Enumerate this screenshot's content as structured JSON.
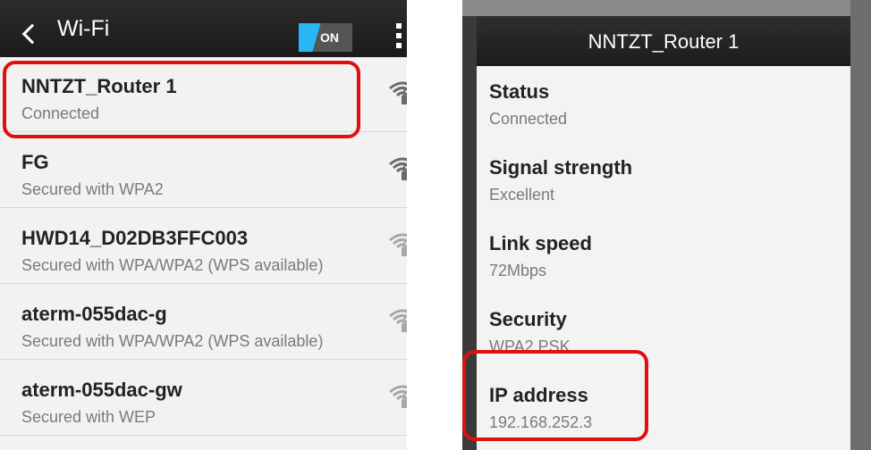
{
  "left": {
    "title": "Wi-Fi",
    "toggle_label": "ON",
    "networks": [
      {
        "name": "NNTZT_Router 1",
        "status": "Connected",
        "signal_icon": "wifi-locked-strong-icon"
      },
      {
        "name": "FG",
        "status": "Secured with WPA2",
        "signal_icon": "wifi-locked-strong-icon"
      },
      {
        "name": "HWD14_D02DB3FFC003",
        "status": "Secured with WPA/WPA2 (WPS available)",
        "signal_icon": "wifi-locked-weak-icon"
      },
      {
        "name": "aterm-055dac-g",
        "status": "Secured with WPA/WPA2 (WPS available)",
        "signal_icon": "wifi-locked-weak-icon"
      },
      {
        "name": "aterm-055dac-gw",
        "status": "Secured with WEP",
        "signal_icon": "wifi-locked-weak-icon"
      }
    ]
  },
  "right": {
    "dialog_title": "NNTZT_Router 1",
    "details": [
      {
        "label": "Status",
        "value": "Connected"
      },
      {
        "label": "Signal strength",
        "value": "Excellent"
      },
      {
        "label": "Link speed",
        "value": "72Mbps"
      },
      {
        "label": "Security",
        "value": "WPA2 PSK"
      },
      {
        "label": "IP address",
        "value": "192.168.252.3"
      }
    ]
  },
  "colors": {
    "highlight": "#e01010",
    "toggle_on": "#29b6f6",
    "action_bar": "#1f1f1f"
  }
}
